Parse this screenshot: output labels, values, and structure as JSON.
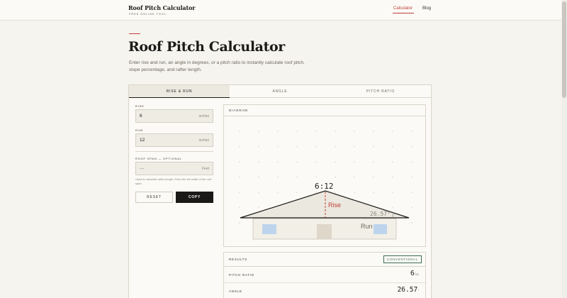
{
  "header": {
    "brand_title": "Roof Pitch Calculator",
    "brand_subtitle": "FREE ONLINE TOOL",
    "nav": [
      {
        "label": "Calculator",
        "active": true
      },
      {
        "label": "Blog",
        "active": false
      }
    ]
  },
  "page": {
    "title": "Roof Pitch Calculator",
    "description": "Enter rise and run, an angle in degrees, or a pitch ratio to instantly calculate roof pitch, slope percentage, and rafter length."
  },
  "tabs": [
    "RISE & RUN",
    "ANGLE",
    "PITCH RATIO"
  ],
  "form": {
    "rise": {
      "label": "RISE",
      "value": "6",
      "unit": "inches"
    },
    "run": {
      "label": "RUN",
      "value": "12",
      "unit": "inches"
    },
    "span": {
      "label": "ROOF SPAN — OPTIONAL",
      "value": "—",
      "unit": "Feet"
    },
    "span_hint": "Used to calculate rafter length. Enter the full width of the roof span.",
    "reset_label": "RESET",
    "copy_label": "COPY"
  },
  "diagram": {
    "label": "DIAGRAM",
    "pitch_label": "6:12",
    "rise_label": "Rise",
    "run_label": "Run",
    "angle_label": "26.57°",
    "colors": {
      "roof_fill": "#ebe8df",
      "rise": "#c0413a",
      "window": "#bdd5ec",
      "door": "#e0d7cb"
    }
  },
  "results": {
    "title": "RESULTS",
    "badge": "CONVENTIONAL",
    "rows": [
      {
        "label": "PITCH RATIO",
        "value": "6",
        "unit": "/12"
      },
      {
        "label": "ANGLE",
        "value": "26.57",
        "unit": "°"
      }
    ]
  }
}
